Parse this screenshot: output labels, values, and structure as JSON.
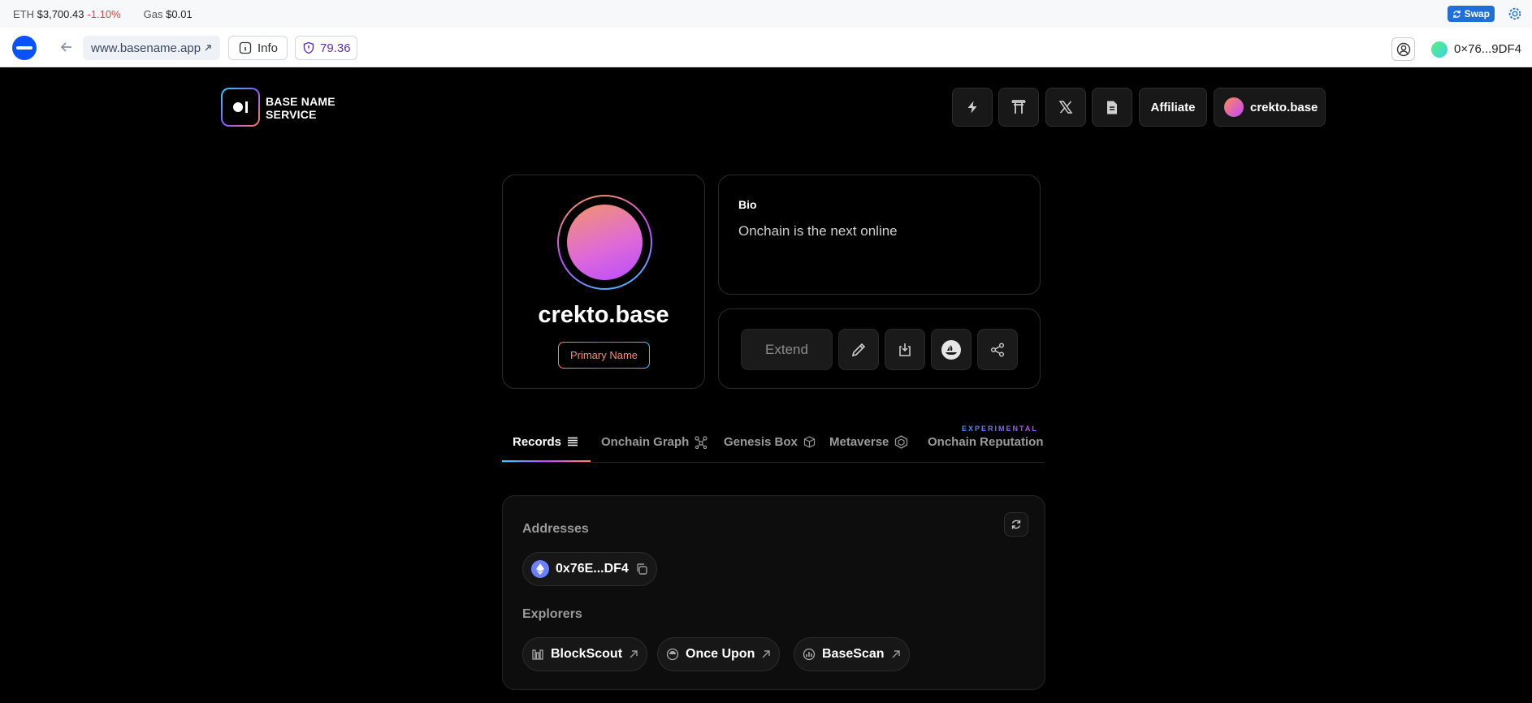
{
  "browser": {
    "eth_label": "ETH",
    "eth_price": "$3,700.43",
    "eth_change": "-1.10%",
    "gas_label": "Gas",
    "gas_value": "$0.01",
    "swap_label": "Swap",
    "url": "www.basename.app",
    "info_label": "Info",
    "score": "79.36",
    "wallet_address": "0×76...9DF4"
  },
  "site": {
    "title_line1": "BASE NAME",
    "title_line2": "SERVICE",
    "affiliate_label": "Affiliate",
    "user_name": "crekto.base"
  },
  "profile": {
    "name": "crekto.base",
    "badge": "Primary Name",
    "bio_title": "Bio",
    "bio_text": "Onchain is the next online",
    "extend_label": "Extend"
  },
  "tabs": [
    {
      "label": "Records"
    },
    {
      "label": "Onchain Graph"
    },
    {
      "label": "Genesis Box"
    },
    {
      "label": "Metaverse"
    },
    {
      "label": "Onchain Reputation"
    }
  ],
  "experimental_label": "EXPERIMENTAL",
  "records": {
    "addresses_label": "Addresses",
    "address": "0x76E...DF4",
    "explorers_label": "Explorers",
    "explorers": [
      {
        "label": "BlockScout"
      },
      {
        "label": "Once Upon"
      },
      {
        "label": "BaseScan"
      }
    ]
  },
  "colors": {
    "accent_blue": "#1e6fd9",
    "base_blue": "#0a52ff",
    "negative": "#d64545",
    "score_purple": "#5b2db3"
  }
}
